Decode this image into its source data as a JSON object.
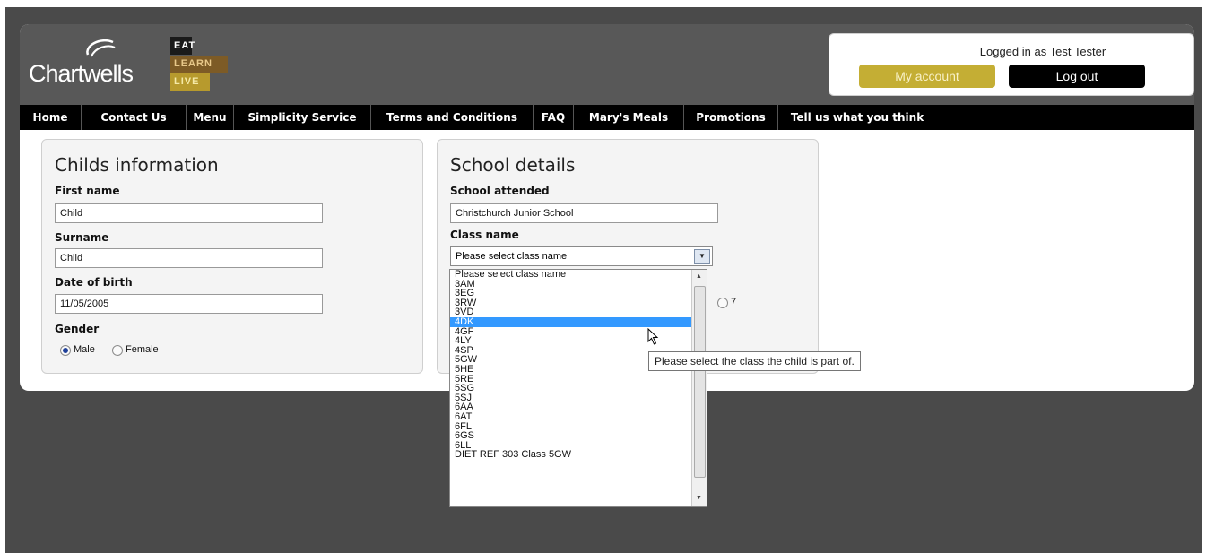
{
  "brand": {
    "name": "Chartwells",
    "tags": [
      "EAT",
      "LEARN",
      "LIVE"
    ]
  },
  "account": {
    "logged_in_text": "Logged in as Test Tester",
    "my_account": "My account",
    "logout": "Log out"
  },
  "nav": [
    "Home",
    "Contact Us",
    "Menu",
    "Simplicity Service",
    "Terms and Conditions",
    "FAQ",
    "Mary's Meals",
    "Promotions",
    "Tell us what you think"
  ],
  "child": {
    "title": "Childs information",
    "first_name_label": "First name",
    "first_name": "Child",
    "surname_label": "Surname",
    "surname": "Child",
    "dob_label": "Date of birth",
    "dob": "11/05/2005",
    "gender_label": "Gender",
    "gender_male": "Male",
    "gender_female": "Female",
    "gender_selected": "Male"
  },
  "school": {
    "title": "School details",
    "attended_label": "School attended",
    "attended": "Christchurch Junior School",
    "class_label": "Class name",
    "class_selected": "Please select class name",
    "partial_radio_label": "7",
    "class_options": [
      "Please select class name",
      "3AM",
      "3EG",
      "3RW",
      "3VD",
      "4DK",
      "4GF",
      "4LY",
      "4SP",
      "5GW",
      "5HE",
      "5RE",
      "5SG",
      "5SJ",
      "6AA",
      "6AT",
      "6FL",
      "6GS",
      "6LL",
      "DIET REF 303 Class 5GW"
    ],
    "highlighted_option": "4DK",
    "tooltip": "Please select the class the child is part of."
  }
}
